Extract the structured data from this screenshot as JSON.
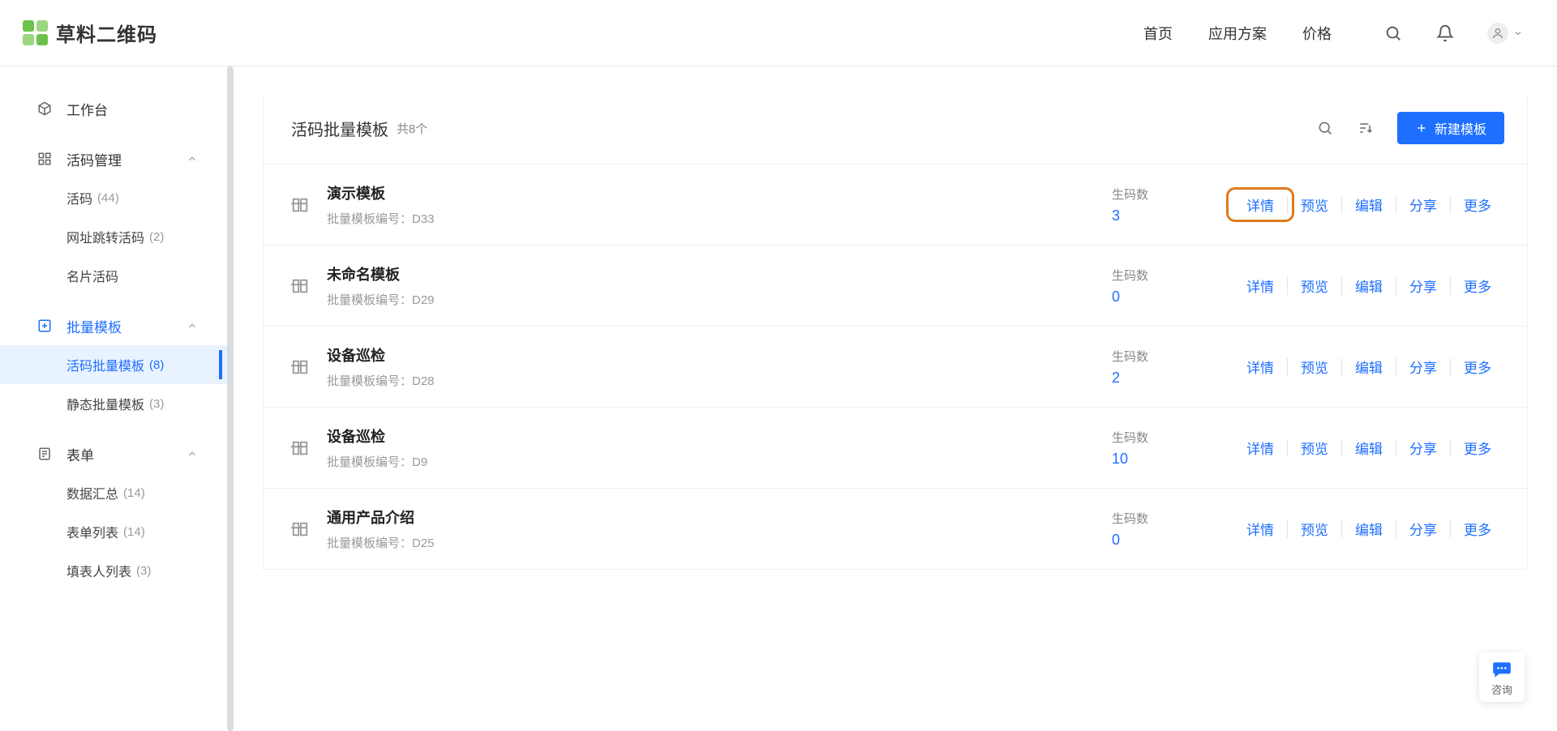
{
  "logo_text": "草料二维码",
  "topnav": {
    "home": "首页",
    "solutions": "应用方案",
    "pricing": "价格"
  },
  "sidebar": {
    "workspace": "工作台",
    "live_code_mgmt": {
      "label": "活码管理"
    },
    "live_code": {
      "label": "活码",
      "count": "(44)"
    },
    "url_jump": {
      "label": "网址跳转活码",
      "count": "(2)"
    },
    "card_code": {
      "label": "名片活码"
    },
    "batch_tpl": {
      "label": "批量模板"
    },
    "live_batch": {
      "label": "活码批量模板",
      "count": "(8)"
    },
    "static_batch": {
      "label": "静态批量模板",
      "count": "(3)"
    },
    "forms": {
      "label": "表单"
    },
    "data_summary": {
      "label": "数据汇总",
      "count": "(14)"
    },
    "form_list": {
      "label": "表单列表",
      "count": "(14)"
    },
    "filler_list": {
      "label": "填表人列表",
      "count": "(3)"
    }
  },
  "panel": {
    "title": "活码批量模板",
    "subtitle": "共8个",
    "new_btn": "新建模板"
  },
  "row_labels": {
    "meta_prefix": "批量模板编号：",
    "count_label": "生码数"
  },
  "actions": {
    "detail": "详情",
    "preview": "预览",
    "edit": "编辑",
    "share": "分享",
    "more": "更多"
  },
  "rows": [
    {
      "title": "演示模板",
      "code": "D33",
      "count": "3"
    },
    {
      "title": "未命名模板",
      "code": "D29",
      "count": "0"
    },
    {
      "title": "设备巡检",
      "code": "D28",
      "count": "2"
    },
    {
      "title": "设备巡检",
      "code": "D9",
      "count": "10"
    },
    {
      "title": "通用产品介绍",
      "code": "D25",
      "count": "0"
    }
  ],
  "consult_label": "咨询"
}
